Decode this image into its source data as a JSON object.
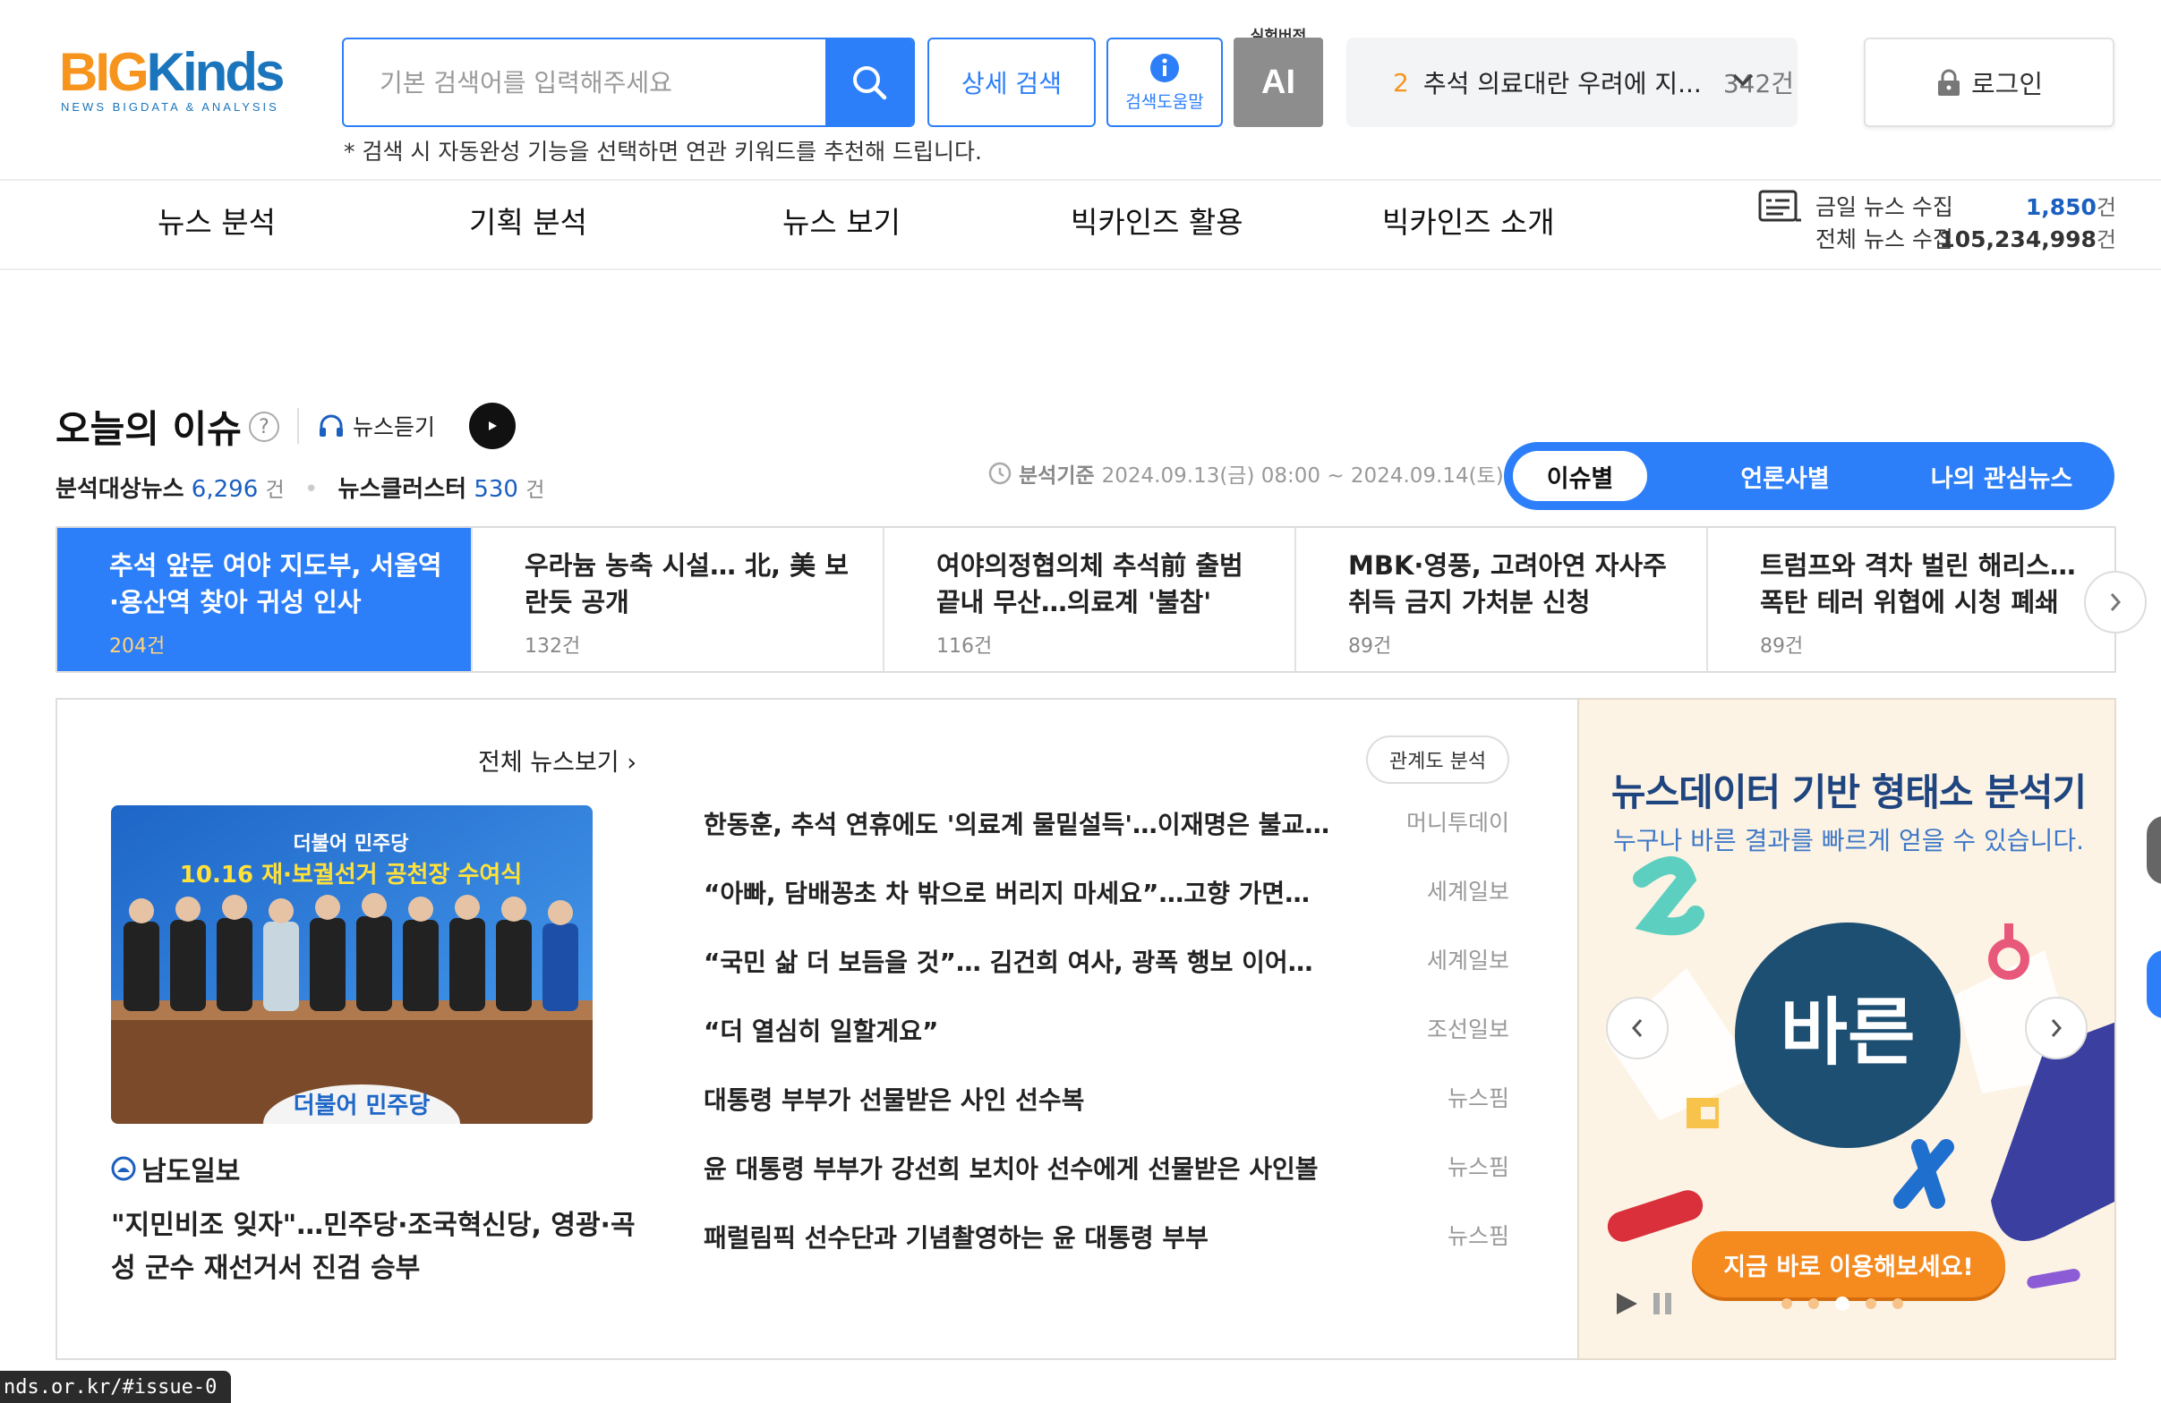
{
  "colors": {
    "accent": "#2d7ff9",
    "brand_orange": "#f7941d",
    "brand_blue": "#1b75bc",
    "cta": "#f58a1f"
  },
  "header": {
    "logo": {
      "big": "BIG",
      "kinds": "Kinds",
      "tagline": "NEWS BIGDATA & ANALYSIS"
    },
    "search": {
      "placeholder": "기본 검색어를 입력해주세요",
      "value": "",
      "hint": "* 검색 시 자동완성 기능을 선택하면 연관 키워드를 추천해 드립니다."
    },
    "detail_search": "상세 검색",
    "search_help": "검색도움말",
    "ai": {
      "badge": "실험버전",
      "label": "AI"
    },
    "trend": {
      "rank": "2",
      "text": "추석 의료대란 우려에 지...",
      "count": "342건"
    },
    "login": "로그인"
  },
  "nav": {
    "items": [
      "뉴스 분석",
      "기획 분석",
      "뉴스 보기",
      "빅카인즈 활용",
      "빅카인즈 소개"
    ]
  },
  "stats": {
    "today_label": "금일 뉴스 수집",
    "today_value": "1,850",
    "today_unit": "건",
    "total_label": "전체 뉴스 수집",
    "total_value": "105,234,998",
    "total_unit": "건"
  },
  "issue": {
    "title": "오늘의 이슈",
    "help": "?",
    "listen": "뉴스듣기",
    "counts": {
      "news_label": "분석대상뉴스",
      "news_value": "6,296",
      "news_unit": "건",
      "cluster_label": "뉴스클러스터",
      "cluster_value": "530",
      "cluster_unit": "건"
    },
    "basis": {
      "label": "분석기준",
      "range": "2024.09.13(금) 08:00 ~ 2024.09.14(토) 08:00"
    },
    "tabs": [
      "이슈별",
      "언론사별",
      "나의 관심뉴스"
    ],
    "cards": [
      {
        "title": "추석 앞둔 여야 지도부, 서울역·용산역 찾아 귀성 인사",
        "count": "204건"
      },
      {
        "title": "우라늄 농축 시설… 北, 美 보란듯 공개",
        "count": "132건"
      },
      {
        "title": "여야의정협의체 추석前 출범 끝내 무산…의료계 '불참'",
        "count": "116건"
      },
      {
        "title": "MBK·영풍, 고려아연 자사주 취득 금지 가처분 신청",
        "count": "89건"
      },
      {
        "title": "트럼프와 격차 벌린 해리스…폭탄 테러 위협에 시청 폐쇄",
        "count": "89건"
      }
    ]
  },
  "news": {
    "all_link": "전체 뉴스보기 ›",
    "rel_analysis": "관계도 분석",
    "photo": {
      "heading": "더불어 민주당",
      "banner": "10.16 재·보궐선거 공천장 수여식",
      "podium": "더불어 민주당"
    },
    "publisher": "남도일보",
    "headline": "\"지민비조 잊자\"…민주당·조국혁신당, 영광·곡성 군수 재선거서 진검 승부",
    "items": [
      {
        "title": "한동훈, 추석 연휴에도 '의료계 물밑설득'…이재명은 불교 지도...",
        "source": "머니투데이"
      },
      {
        "title": "“아빠, 담배꽁초 차 밖으로 버리지 마세요”…고향 가면서 ‘휙휙’ ...",
        "source": "세계일보"
      },
      {
        "title": "“국민 삶 더 보듬을 것”… 김건희 여사, 광폭 행보 이어가나",
        "source": "세계일보"
      },
      {
        "title": "“더 열심히 일할게요”",
        "source": "조선일보"
      },
      {
        "title": "대통령 부부가 선물받은 사인 선수복",
        "source": "뉴스핌"
      },
      {
        "title": "윤 대통령 부부가 강선희 보치아 선수에게 선물받은 사인볼",
        "source": "뉴스핌"
      },
      {
        "title": "패럴림픽 선수단과 기념촬영하는 윤 대통령 부부",
        "source": "뉴스핌"
      }
    ]
  },
  "ad": {
    "title": "뉴스데이터 기반 형태소 분석기",
    "subtitle": "누구나 바른 결과를 빠르게 얻을 수 있습니다.",
    "logo_text": "바른",
    "cta": "지금 바로 이용해보세요!"
  },
  "status_url": "nds.or.kr/#issue-0"
}
